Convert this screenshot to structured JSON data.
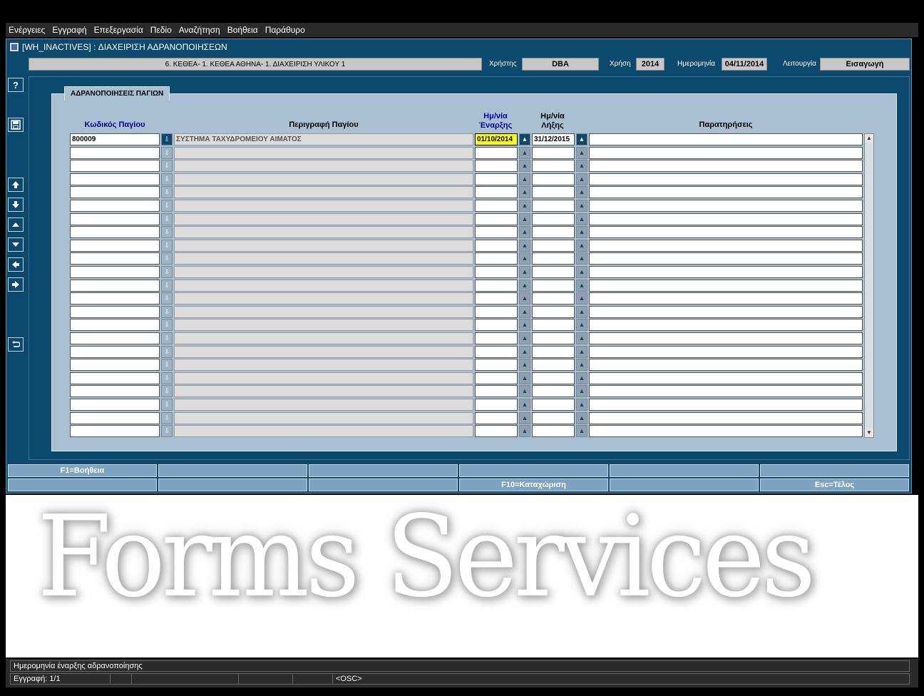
{
  "menu": [
    "Ενέργειες",
    "Εγγραφή",
    "Επεξεργασία",
    "Πεδίο",
    "Αναζήτηση",
    "Βοήθεια",
    "Παράθυρο"
  ],
  "window": {
    "title": "[WH_INACTIVES]   :  ΔΙΑΧΕΙΡΙΣΗ ΑΔΡΑΝΟΠΟΙΗΣΕΩΝ"
  },
  "context": {
    "org_path": "6. ΚΕΘΕΑ- 1. ΚΕΘΕΑ ΑΘΗΝΑ- 1. ΔΙΑΧΕΙΡΙΣΗ ΥΛΙΚΟΥ 1",
    "user_label": "Χρήστης",
    "user": "DBA",
    "year_label": "Χρήση",
    "year": "2014",
    "date_label": "Ημερομηνία",
    "date": "04/11/2014",
    "mode_label": "Λειτουργία",
    "mode": "Εισαγωγή"
  },
  "side_toolbar": {
    "help": "?",
    "icons": [
      "help-icon",
      "save-icon",
      "first-record-icon",
      "last-record-icon",
      "previous-record-icon",
      "next-record-icon",
      "previous-block-icon",
      "next-block-icon",
      "exit-icon"
    ]
  },
  "panel": {
    "tab_label": "ΑΔΡΑΝΟΠΟΙΗΣΕΙΣ ΠΑΓΙΩΝ",
    "headers": {
      "code": "Κωδικός Παγίου",
      "description": "Περιγραφή Παγίου",
      "start_date_1": "Ημ/νία",
      "start_date_2": "Έναρξης",
      "end_date_1": "Ημ/νία",
      "end_date_2": "Λήξης",
      "notes": "Παρατηρήσεις"
    },
    "rows": [
      {
        "code": "800009",
        "description": "ΣΥΣΤΗΜΑ ΤΑΧΥΔΡΟΜΕΙΟΥ ΑΙΜΑΤΟΣ",
        "start": "01/10/2014",
        "end": "31/12/2015",
        "notes": ""
      }
    ],
    "empty_row_count": 22
  },
  "function_keys": {
    "row1": [
      "F1=Βοήθεια",
      "",
      "",
      "",
      "",
      ""
    ],
    "row2": [
      "",
      "",
      "",
      "F10=Καταχώριση",
      "",
      "Esc=Τέλος"
    ]
  },
  "watermark": "Forms Services",
  "status": {
    "message": "Ημερομηνία έναρξης αδρανοποίησης",
    "record": "Εγγραφή: 1/1",
    "osc": "<OSC>"
  },
  "colors": {
    "window_bg": "#0b4a6e",
    "panel_bg": "#a9c0d3",
    "active_field": "#ffff00",
    "header_blue": "#00009c"
  }
}
